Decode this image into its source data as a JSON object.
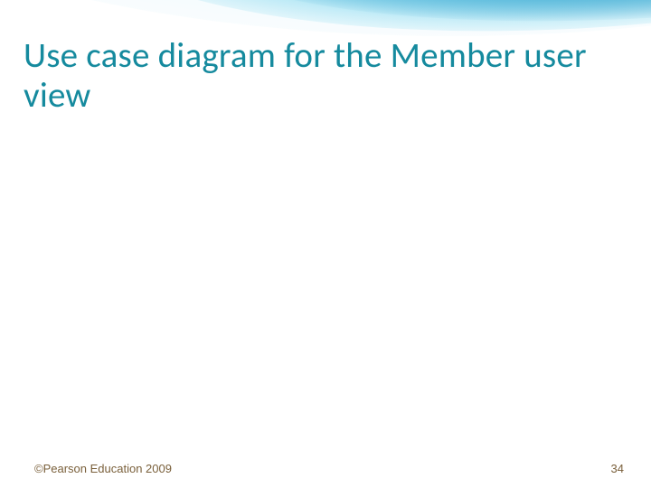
{
  "slide": {
    "title": "Use case diagram for the Member user view",
    "footer_copyright": "©Pearson Education 2009",
    "page_number": "34"
  }
}
